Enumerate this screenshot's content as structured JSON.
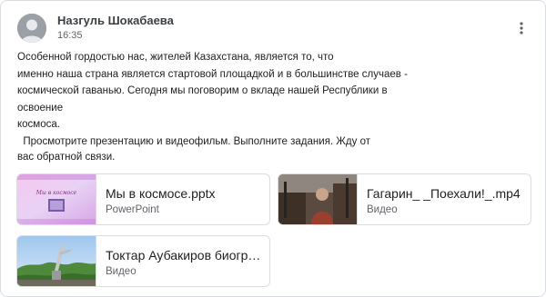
{
  "post": {
    "author": "Назгуль Шокабаева",
    "time": "16:35",
    "paragraph1": [
      "Особенной гордостью нас, жителей Казахстана, является то, что",
      "именно наша страна является стартовой площадкой и в большинстве случаев -",
      "космической гаванью. Сегодня мы поговорим о вкладе нашей Республики в освоение",
      "космоса."
    ],
    "paragraph2": [
      "  Просмотрите презентацию и видеофильм. Выполните задания. Жду от",
      "вас обратной связи."
    ]
  },
  "attachments": [
    {
      "title": "Мы в космосе.pptx",
      "type": "PowerPoint",
      "thumb_caption": "Мы в космосе"
    },
    {
      "title": "Гагарин_ _Поехали!_.mp4",
      "type": "Видео"
    },
    {
      "title": "Токтар Аубакиров биогр…",
      "type": "Видео"
    }
  ],
  "colors": {
    "text": "#202124",
    "secondary": "#5f6368",
    "border": "#dadce0",
    "avatar": "#9aa0a6"
  },
  "icons": {
    "avatar": "person-silhouette-icon",
    "more": "three-dot-vertical-icon"
  }
}
